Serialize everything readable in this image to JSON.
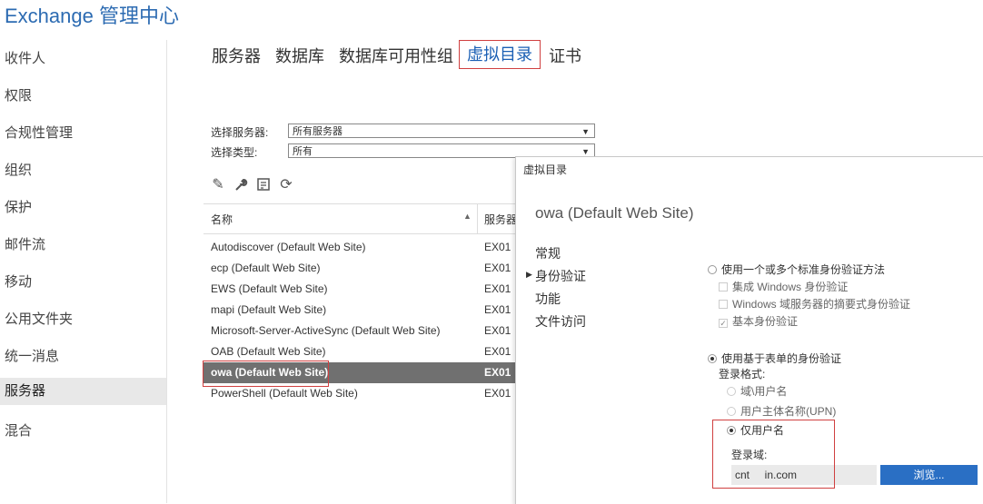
{
  "app_title": "Exchange 管理中心",
  "nav": [
    "收件人",
    "权限",
    "合规性管理",
    "组织",
    "保护",
    "邮件流",
    "移动",
    "公用文件夹",
    "统一消息",
    "服务器",
    "混合"
  ],
  "nav_selected": "服务器",
  "tabs": [
    "服务器",
    "数据库",
    "数据库可用性组",
    "虚拟目录",
    "证书"
  ],
  "tab_active": "虚拟目录",
  "filters": {
    "server_label": "选择服务器:",
    "server_value": "所有服务器",
    "type_label": "选择类型:",
    "type_value": "所有"
  },
  "toolbar": {
    "icons": [
      "edit-icon",
      "wrench-icon",
      "export-icon",
      "refresh-icon"
    ]
  },
  "list": {
    "col_name": "名称",
    "col_server": "服务器",
    "rows": [
      {
        "name": "Autodiscover (Default Web Site)",
        "server": "EX01"
      },
      {
        "name": "ecp (Default Web Site)",
        "server": "EX01"
      },
      {
        "name": "EWS (Default Web Site)",
        "server": "EX01"
      },
      {
        "name": "mapi (Default Web Site)",
        "server": "EX01"
      },
      {
        "name": "Microsoft-Server-ActiveSync (Default Web Site)",
        "server": "EX01"
      },
      {
        "name": "OAB (Default Web Site)",
        "server": "EX01"
      },
      {
        "name": "owa (Default Web Site)",
        "server": "EX01"
      },
      {
        "name": "PowerShell (Default Web Site)",
        "server": "EX01"
      }
    ],
    "selected_row": 6
  },
  "dialog": {
    "window_title": "虚拟目录",
    "heading": "owa (Default Web Site)",
    "nav": [
      "常规",
      "身份验证",
      "功能",
      "文件访问"
    ],
    "nav_current": "身份验证",
    "auth": {
      "standard_label": "使用一个或多个标准身份验证方法",
      "integrated_windows": "集成 Windows 身份验证",
      "digest": "Windows 域服务器的摘要式身份验证",
      "basic": "基本身份验证",
      "forms_label": "使用基于表单的身份验证",
      "logon_format_label": "登录格式:",
      "domain_user": "域\\用户名",
      "upn": "用户主体名称(UPN)",
      "user_only": "仅用户名",
      "logon_domain_label": "登录域:",
      "logon_domain_value": "cnt     in.com",
      "browse_button": "浏览..."
    }
  }
}
